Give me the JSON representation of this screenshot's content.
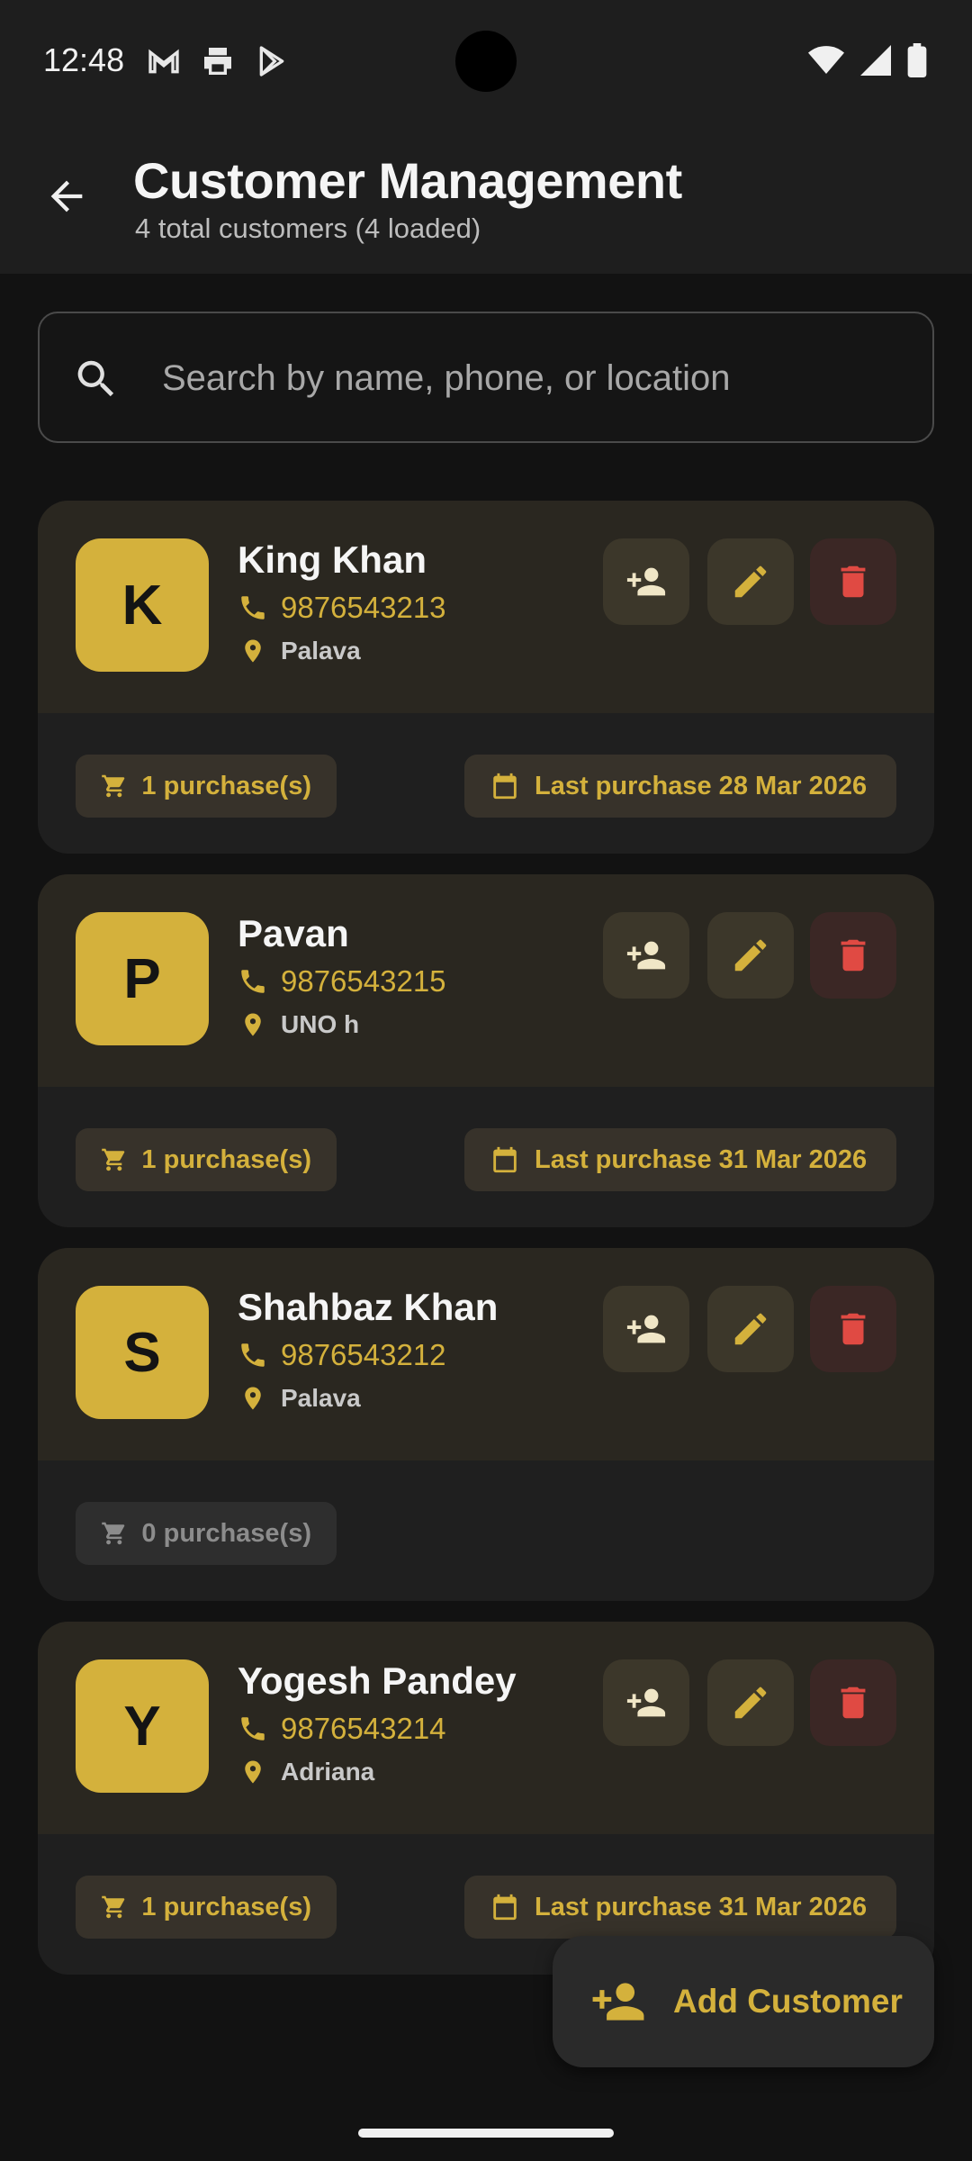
{
  "status_bar": {
    "time": "12:48",
    "left_icons": [
      "gmail-icon",
      "printer-icon",
      "play-store-icon"
    ],
    "right_icons": [
      "wifi-icon",
      "signal-icon",
      "battery-icon"
    ]
  },
  "app_bar": {
    "title": "Customer Management",
    "subtitle": "4 total customers (4 loaded)"
  },
  "search": {
    "placeholder": "Search by name, phone, or location",
    "value": ""
  },
  "customers": [
    {
      "initial": "K",
      "name": "King Khan",
      "phone": "9876543213",
      "location": "Palava",
      "purchases": "1 purchase(s)",
      "last_purchase": "Last purchase 28 Mar 2026"
    },
    {
      "initial": "P",
      "name": "Pavan",
      "phone": "9876543215",
      "location": "UNO h",
      "purchases": "1 purchase(s)",
      "last_purchase": "Last purchase 31 Mar 2026"
    },
    {
      "initial": "S",
      "name": "Shahbaz Khan",
      "phone": "9876543212",
      "location": "Palava",
      "purchases": "0 purchase(s)",
      "last_purchase": ""
    },
    {
      "initial": "Y",
      "name": "Yogesh Pandey",
      "phone": "9876543214",
      "location": "Adriana",
      "purchases": "1 purchase(s)",
      "last_purchase": "Last purchase 31 Mar 2026"
    }
  ],
  "fab": {
    "label": "Add Customer"
  },
  "colors": {
    "accent": "#d4b13c",
    "danger": "#e04a43",
    "background": "#121212",
    "card_top": "#2a2720",
    "card_bottom": "#1f1f1f"
  }
}
